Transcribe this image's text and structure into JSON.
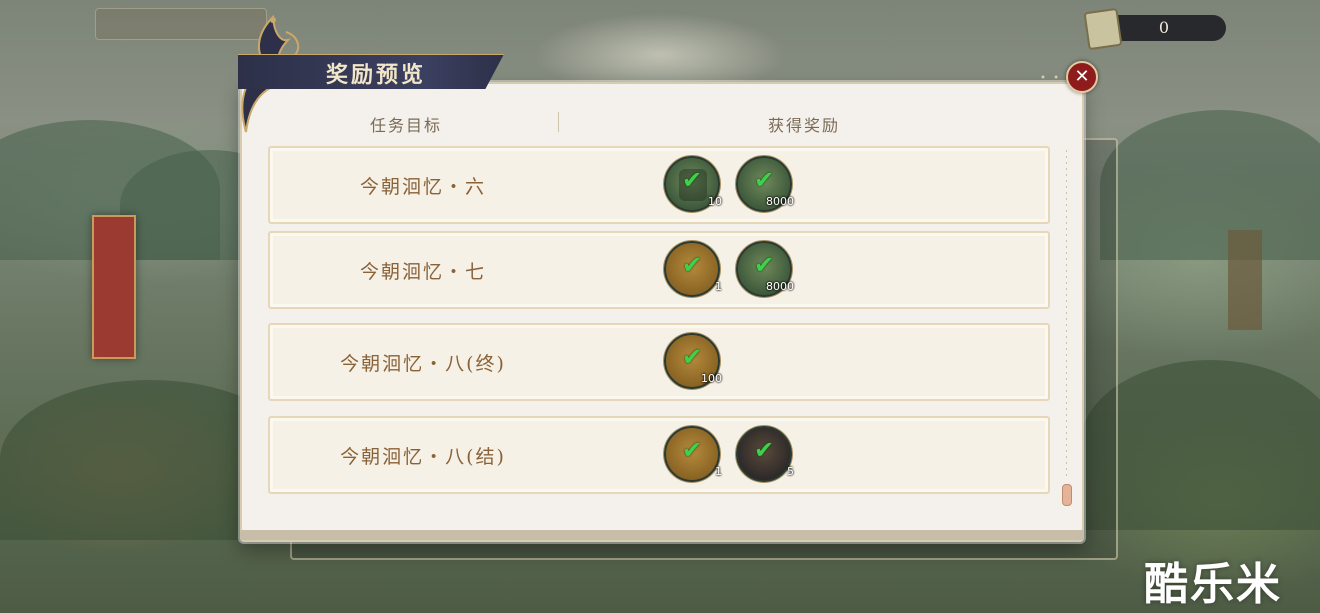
{
  "header": {
    "title": "奖励预览",
    "close_icon": "✕",
    "dots": "• • •"
  },
  "currency": {
    "icon": "scroll-ticket-icon",
    "value": "0"
  },
  "table": {
    "col_target": "任务目标",
    "col_reward": "获得奖励"
  },
  "rows": [
    {
      "label": "今朝洄忆・六",
      "rewards": [
        {
          "icon": "book-icon",
          "style": "green",
          "qty": "10",
          "claimed": true
        },
        {
          "icon": "coin-icon",
          "style": "green",
          "qty": "8000",
          "claimed": true
        }
      ]
    },
    {
      "label": "今朝洄忆・七",
      "rewards": [
        {
          "icon": "compass-icon",
          "style": "gold",
          "qty": "1",
          "claimed": true
        },
        {
          "icon": "coin-icon",
          "style": "green",
          "qty": "8000",
          "claimed": true
        }
      ]
    },
    {
      "label": "今朝洄忆・八(终)",
      "rewards": [
        {
          "icon": "feather-icon",
          "style": "gold",
          "qty": "100",
          "claimed": true
        }
      ]
    },
    {
      "label": "今朝洄忆・八(结)",
      "rewards": [
        {
          "icon": "flower-hairpin-icon",
          "style": "gold",
          "qty": "1",
          "claimed": true
        },
        {
          "icon": "character-portrait-icon",
          "style": "dark",
          "qty": "5",
          "claimed": true
        }
      ]
    }
  ],
  "check_glyph": "✔",
  "watermark": "酷乐米"
}
